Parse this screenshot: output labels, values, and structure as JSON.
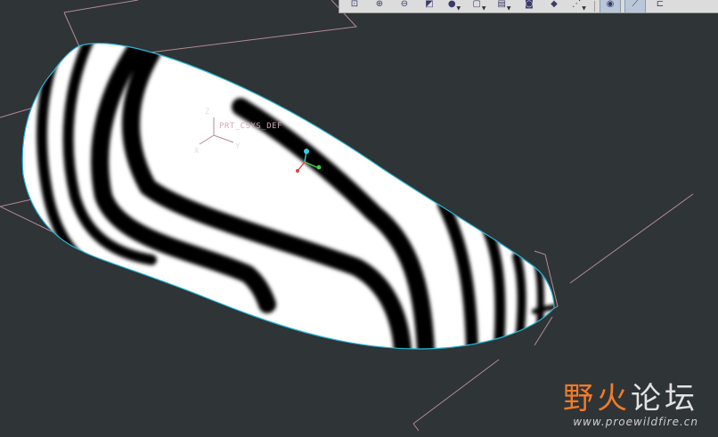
{
  "viewport": {
    "background": "#2f3436",
    "datum_color": "#b48a96",
    "surface_edge_color": "#28b8d8",
    "stripe_dark": "#000000",
    "stripe_light": "#ffffff",
    "csys_label": "PRT_CSYS_DEF",
    "axis_x": "X",
    "axis_y": "Y",
    "axis_z": "Z"
  },
  "toolbar": {
    "buttons": [
      {
        "icon": "zoom-fit-icon",
        "glyph": "⊡"
      },
      {
        "icon": "zoom-in-icon",
        "glyph": "⊕"
      },
      {
        "icon": "zoom-out-icon",
        "glyph": "⊖"
      },
      {
        "icon": "repaint-icon",
        "glyph": "◩"
      },
      {
        "icon": "shading-icon",
        "glyph": "●"
      },
      {
        "icon": "saved-views-icon",
        "glyph": "▢"
      },
      {
        "icon": "layers-icon",
        "glyph": "▤"
      },
      {
        "icon": "camera-icon",
        "glyph": "◙"
      },
      {
        "icon": "datum-plane-icon",
        "glyph": "◆"
      },
      {
        "icon": "datum-points-icon",
        "glyph": "⋰"
      },
      {
        "icon": "visibility-icon",
        "glyph": "◉",
        "selected": true
      },
      {
        "icon": "axis-display-icon",
        "glyph": "⟋",
        "selected": true
      },
      {
        "icon": "csys-display-icon",
        "glyph": "⊏"
      }
    ]
  },
  "watermark": {
    "title_accent": "野火",
    "title_rest": "论坛",
    "url": "www.proewildfire.cn"
  }
}
